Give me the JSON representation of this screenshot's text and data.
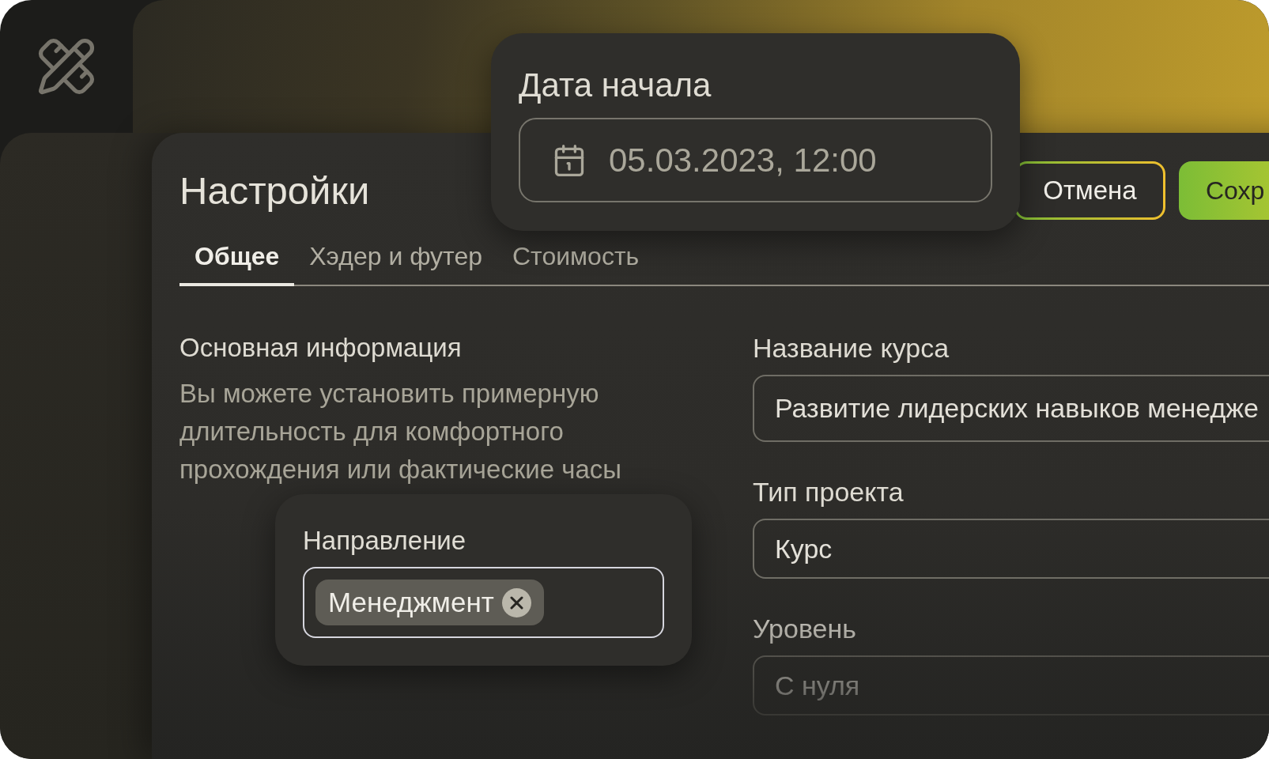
{
  "settings": {
    "title": "Настройки",
    "actions": [
      {
        "label": "Отмена",
        "kind": "secondary"
      },
      {
        "label": "Сохр",
        "kind": "primary"
      }
    ],
    "tabs": [
      {
        "label": "Общее",
        "selected": true
      },
      {
        "label": "Хэдер и футер",
        "selected": false
      },
      {
        "label": "Стоимость",
        "selected": false
      }
    ],
    "section": {
      "title": "Основная информация",
      "description": "Вы можете установить примерную длительность для комфортного прохождения или фактические часы"
    },
    "fields": [
      {
        "label": "Название курса",
        "value": "Развитие лидерских навыков менедже"
      },
      {
        "label": "Тип проекта",
        "value": "Курс"
      },
      {
        "label": "Уровень",
        "value": "С нуля"
      }
    ]
  },
  "date_popover": {
    "label": "Дата начала",
    "value": "05.03.2023, 12:00"
  },
  "direction_popover": {
    "label": "Направление",
    "tags": [
      {
        "label": "Менеджмент"
      }
    ]
  }
}
